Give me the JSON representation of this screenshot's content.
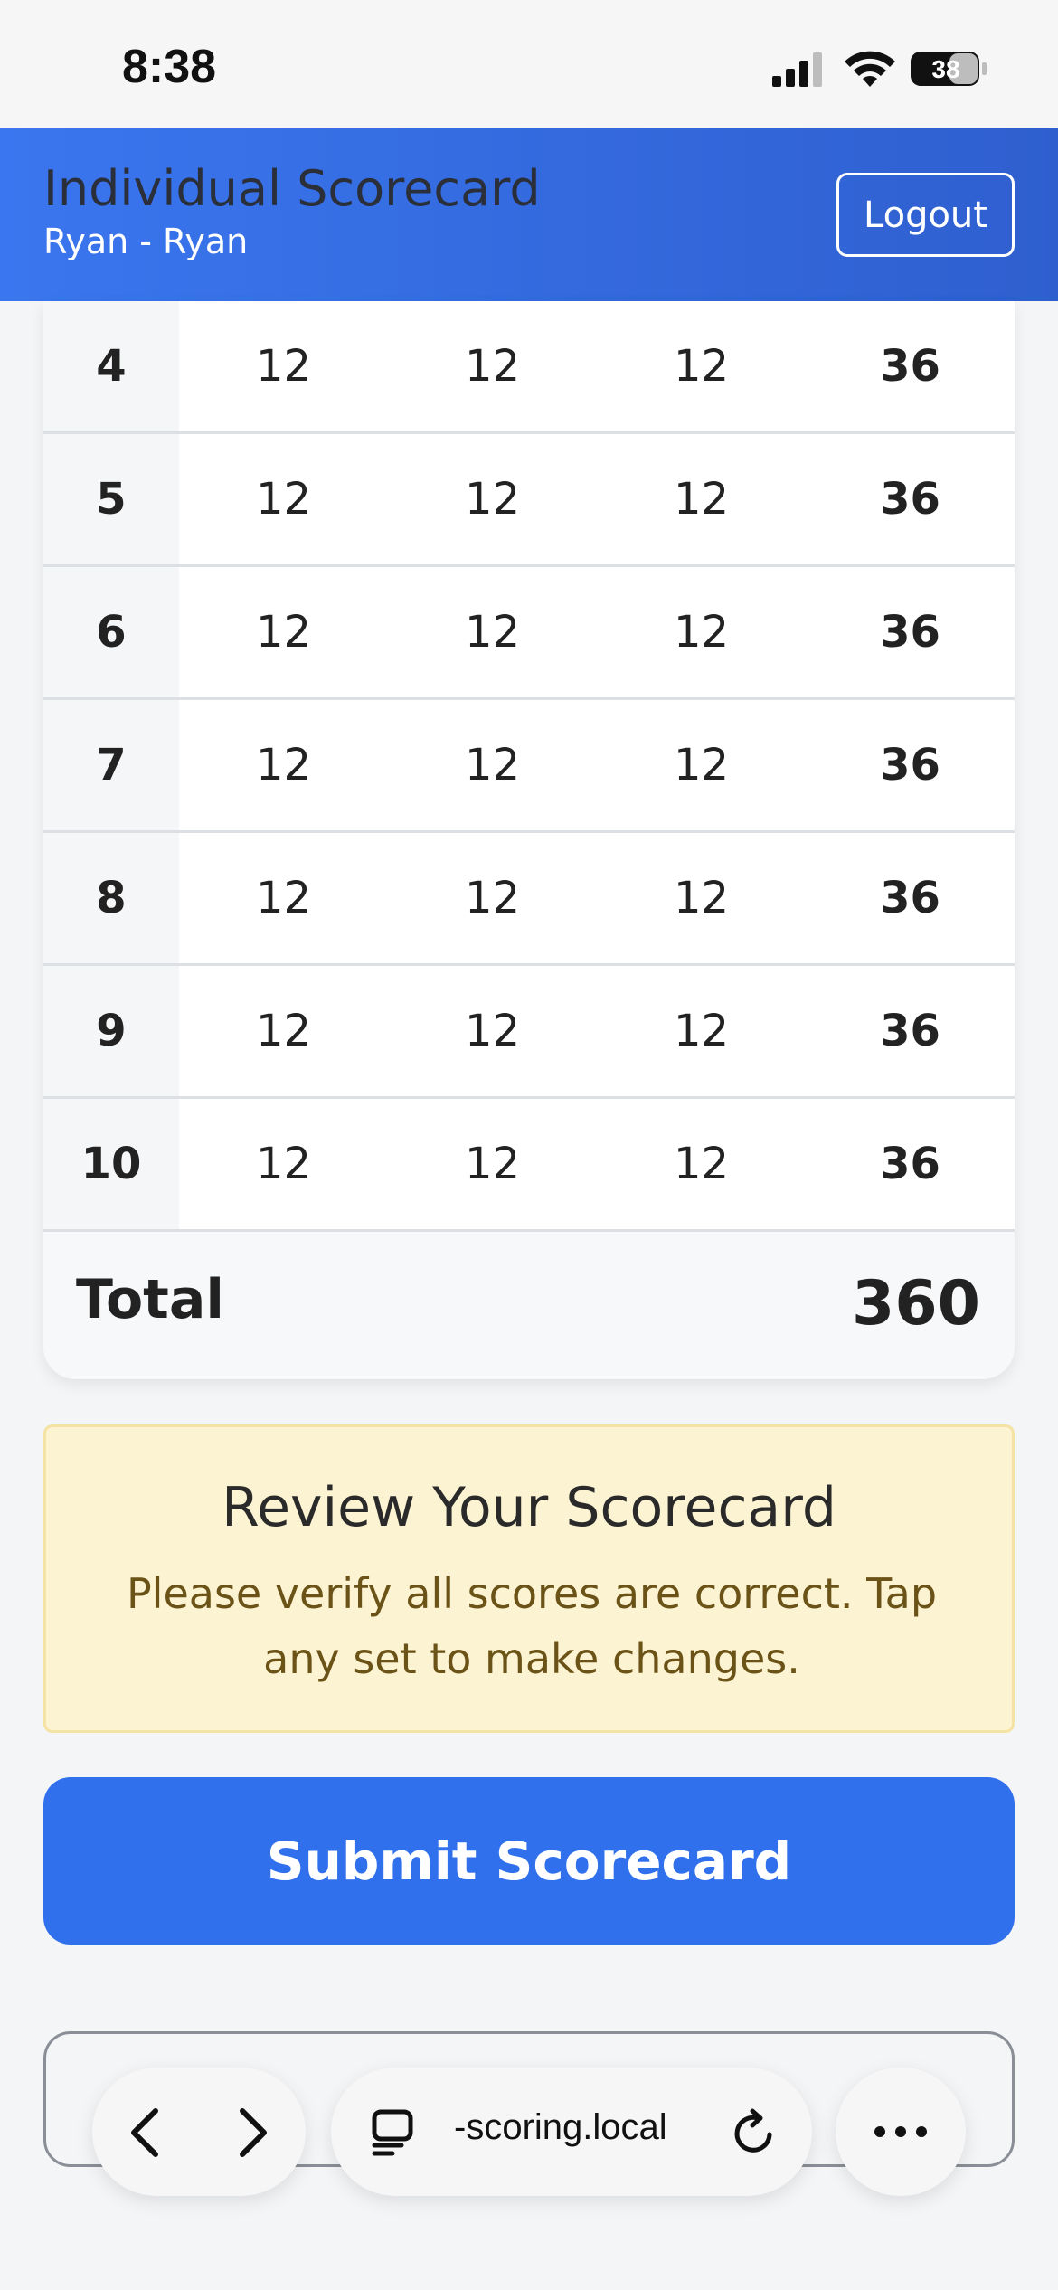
{
  "status_bar": {
    "time": "8:38",
    "battery": "38"
  },
  "header": {
    "title": "Individual Scorecard",
    "subtitle": "Ryan - Ryan",
    "logout_label": "Logout"
  },
  "scorecard": {
    "rows": [
      {
        "set": "4",
        "scores": [
          "12",
          "12",
          "12"
        ],
        "total": "36"
      },
      {
        "set": "5",
        "scores": [
          "12",
          "12",
          "12"
        ],
        "total": "36"
      },
      {
        "set": "6",
        "scores": [
          "12",
          "12",
          "12"
        ],
        "total": "36"
      },
      {
        "set": "7",
        "scores": [
          "12",
          "12",
          "12"
        ],
        "total": "36"
      },
      {
        "set": "8",
        "scores": [
          "12",
          "12",
          "12"
        ],
        "total": "36"
      },
      {
        "set": "9",
        "scores": [
          "12",
          "12",
          "12"
        ],
        "total": "36"
      },
      {
        "set": "10",
        "scores": [
          "12",
          "12",
          "12"
        ],
        "total": "36"
      }
    ],
    "total_label": "Total",
    "total_value": "360"
  },
  "review": {
    "title": "Review Your Scorecard",
    "text": "Please verify all scores are correct. Tap any set to make changes."
  },
  "submit_label": "Submit Scorecard",
  "browser": {
    "url": "-scoring.local",
    "icons": [
      "back-icon",
      "forward-icon",
      "tabs-icon",
      "reload-icon",
      "more-icon"
    ]
  }
}
